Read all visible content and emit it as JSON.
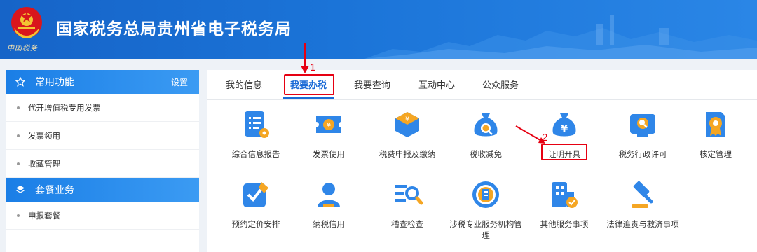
{
  "header": {
    "title": "国家税务总局贵州省电子税务局",
    "emblem_text": "中国税务"
  },
  "sidebar": {
    "common": {
      "title": "常用功能",
      "settings": "设置"
    },
    "common_items": [
      "代开增值税专用发票",
      "发票领用",
      "收藏管理"
    ],
    "package": {
      "title": "套餐业务"
    },
    "package_items": [
      "申报套餐"
    ]
  },
  "tabs": [
    "我的信息",
    "我要办税",
    "我要查询",
    "互动中心",
    "公众服务"
  ],
  "active_tab": "我要办税",
  "annotations": {
    "marker1": "1",
    "marker2": "2"
  },
  "functions": [
    {
      "label": "综合信息报告",
      "icon": "report-doc-icon"
    },
    {
      "label": "发票使用",
      "icon": "ticket-icon"
    },
    {
      "label": "税费申报及缴纳",
      "icon": "yuan-box-icon"
    },
    {
      "label": "税收减免",
      "icon": "money-bag-search-icon"
    },
    {
      "label": "证明开具",
      "icon": "money-bag-yuan-icon"
    },
    {
      "label": "税务行政许可",
      "icon": "monitor-search-icon"
    },
    {
      "label": "核定管理",
      "icon": "certificate-icon"
    },
    {
      "label": "预约定价安排",
      "icon": "check-pen-icon"
    },
    {
      "label": "纳税信用",
      "icon": "person-icon"
    },
    {
      "label": "稽查检查",
      "icon": "list-magnifier-icon"
    },
    {
      "label": "涉税专业服务机构管理",
      "icon": "institution-seal-icon"
    },
    {
      "label": "其他服务事项",
      "icon": "building-check-icon"
    },
    {
      "label": "法律追责与救济事项",
      "icon": "gavel-icon"
    }
  ],
  "colors": {
    "brand_blue": "#1a6ad6",
    "annotation_red": "#e60012",
    "icon_blue": "#2f86e8",
    "icon_orange": "#f5a623"
  }
}
